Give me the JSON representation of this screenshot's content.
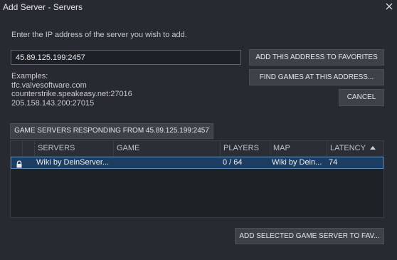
{
  "window": {
    "title": "Add Server - Servers",
    "close_icon": "close-icon"
  },
  "instruction": "Enter the IP address of the server you wish to add.",
  "address_input": {
    "value": "45.89.125.199:2457"
  },
  "buttons": {
    "add_to_favorites": "ADD THIS ADDRESS TO FAVORITES",
    "find_games": "FIND GAMES AT THIS ADDRESS...",
    "cancel": "CANCEL",
    "responding": "GAME SERVERS RESPONDING FROM 45.89.125.199:2457",
    "add_selected": "ADD SELECTED GAME SERVER TO FAV..."
  },
  "examples": {
    "label": "Examples:",
    "items": [
      "tfc.valvesoftware.com",
      "counterstrike.speakeasy.net:27016",
      "205.158.143.200:27015"
    ]
  },
  "table": {
    "headers": {
      "servers": "SERVERS",
      "game": "GAME",
      "players": "PLAYERS",
      "map": "MAP",
      "latency": "LATENCY"
    },
    "sort": {
      "column": "latency",
      "direction": "ascending"
    },
    "rows": [
      {
        "locked": true,
        "server": "Wiki by DeinServer...",
        "game": "",
        "players": "0 / 64",
        "map": "Wiki by Dein...",
        "latency": "74",
        "selected": true
      }
    ]
  },
  "colors": {
    "background": "#272a30",
    "selected_row": "#1c3d62",
    "button": "#3d4148"
  }
}
